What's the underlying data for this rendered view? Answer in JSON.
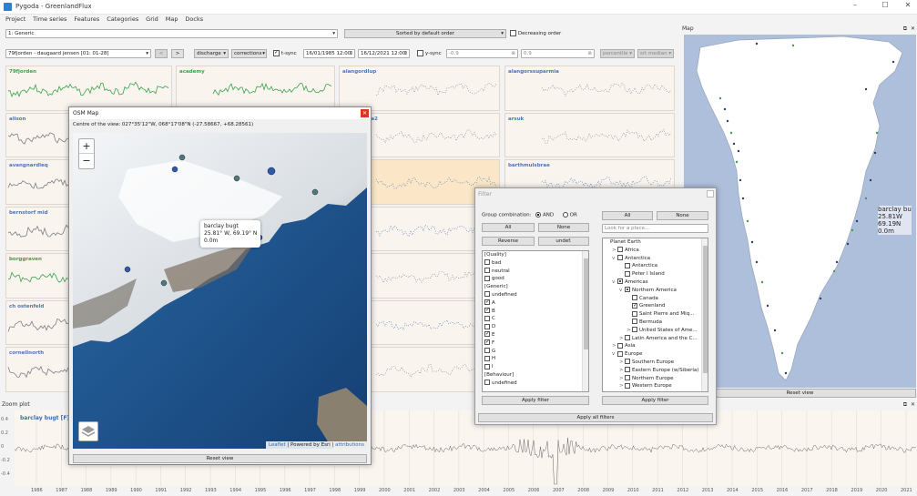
{
  "window": {
    "title": "Pygoda - GreenlandFlux",
    "minimize": "–",
    "maximize": "☐",
    "close": "✕"
  },
  "menu": [
    "Project",
    "Time series",
    "Features",
    "Categories",
    "Grid",
    "Map",
    "Docks"
  ],
  "toolbar1": {
    "group_select": "1: Generic",
    "sort_select": "Sorted by default order",
    "decreasing_label": "Decreasing order"
  },
  "toolbar2": {
    "station_select": "79fjorden - daugaard jensen [01: 01-28]",
    "prev": "<",
    "next": ">",
    "field_select": "discharge",
    "corrections_select": "corrections",
    "tsync_label": "t-sync",
    "date_from": "16/01/1985 12:00",
    "date_to": "16/12/2021 12:00",
    "ysync_label": "y-sync",
    "ymin": "-0.9",
    "ymax": "0.9",
    "percentile": "percentile",
    "sort_median": "srt median"
  },
  "panels": [
    "79fjorden",
    "academy",
    "alangordlup",
    "alangorssuparmia",
    "alison",
    "",
    "kangerdlua2",
    "arsuk",
    "avangnardleq",
    "",
    "…ugt [F]",
    "barthmulsbrae",
    "bernstorf mid",
    "",
    "…north2",
    "",
    "borggraven",
    "",
    "…ischer",
    "",
    "ch ostenfeld",
    "",
    "…V",
    "",
    "cornellnorth",
    "",
    "",
    ""
  ],
  "osm": {
    "title": "OSM Map",
    "centre": "Centre of the view: 027°35'12\"W, 068°17'08\"N (-27.58667, +68.28561)",
    "zoom_in": "+",
    "zoom_out": "−",
    "popup_name": "barclay bugt",
    "popup_coords": "25.81° W, 69.19° N",
    "popup_elev": "0.0m",
    "attribution_leaflet": "Leaflet",
    "attribution_esri": " | Powered by Esri | ",
    "attribution_link": "attributions",
    "reset": "Reset view",
    "layers_icon": "layers-icon"
  },
  "filter": {
    "title": "Filter",
    "group_combination": "Group combination:",
    "and_label": "AND",
    "or_label": "OR",
    "all": "All",
    "none": "None",
    "reverse": "Reverse",
    "undef": "undef.",
    "left_items": [
      {
        "label": "[Quality]",
        "cb": false,
        "show": false
      },
      {
        "label": "bad",
        "cb": true,
        "on": false
      },
      {
        "label": "neutral",
        "cb": true,
        "on": false
      },
      {
        "label": "good",
        "cb": true,
        "on": false
      },
      {
        "label": "[Generic]",
        "cb": false,
        "show": false
      },
      {
        "label": "undefined",
        "cb": true,
        "on": false
      },
      {
        "label": "A",
        "cb": true,
        "on": true
      },
      {
        "label": "B",
        "cb": true,
        "on": true
      },
      {
        "label": "C",
        "cb": true,
        "on": false
      },
      {
        "label": "D",
        "cb": true,
        "on": false
      },
      {
        "label": "E",
        "cb": true,
        "on": true
      },
      {
        "label": "F",
        "cb": true,
        "on": true
      },
      {
        "label": "G",
        "cb": true,
        "on": false
      },
      {
        "label": "H",
        "cb": true,
        "on": false
      },
      {
        "label": "I",
        "cb": true,
        "on": false
      },
      {
        "label": "[Behaviour]",
        "cb": false,
        "show": false
      },
      {
        "label": "undefined",
        "cb": true,
        "on": false
      }
    ],
    "right_all": "All",
    "right_none": "None",
    "place_placeholder": "Look for a place...",
    "tree": [
      {
        "label": "Planet Earth",
        "lvl": 0,
        "arrow": "",
        "cb": false
      },
      {
        "label": "Africa",
        "lvl": 1,
        "arrow": ">",
        "cb": true,
        "on": false
      },
      {
        "label": "Antarctica",
        "lvl": 1,
        "arrow": "v",
        "cb": true,
        "on": false
      },
      {
        "label": "Antarctica",
        "lvl": 2,
        "arrow": "",
        "cb": true,
        "on": false
      },
      {
        "label": "Peter I Island",
        "lvl": 2,
        "arrow": "",
        "cb": true,
        "on": false
      },
      {
        "label": "Americas",
        "lvl": 1,
        "arrow": "v",
        "cb": true,
        "on": "part"
      },
      {
        "label": "Northern America",
        "lvl": 2,
        "arrow": "v",
        "cb": true,
        "on": "part"
      },
      {
        "label": "Canada",
        "lvl": 3,
        "arrow": "",
        "cb": true,
        "on": false
      },
      {
        "label": "Greenland",
        "lvl": 3,
        "arrow": "",
        "cb": true,
        "on": true
      },
      {
        "label": "Saint Pierre and Miq...",
        "lvl": 3,
        "arrow": "",
        "cb": true,
        "on": false
      },
      {
        "label": "Bermuda",
        "lvl": 3,
        "arrow": "",
        "cb": true,
        "on": false
      },
      {
        "label": "United States of Ame...",
        "lvl": 3,
        "arrow": ">",
        "cb": true,
        "on": false
      },
      {
        "label": "Latin America and the C...",
        "lvl": 2,
        "arrow": ">",
        "cb": true,
        "on": false
      },
      {
        "label": "Asia",
        "lvl": 1,
        "arrow": ">",
        "cb": true,
        "on": false
      },
      {
        "label": "Europe",
        "lvl": 1,
        "arrow": "v",
        "cb": true,
        "on": false
      },
      {
        "label": "Southern Europe",
        "lvl": 2,
        "arrow": ">",
        "cb": true,
        "on": false
      },
      {
        "label": "Eastern Europe (w/Siberia)",
        "lvl": 2,
        "arrow": ">",
        "cb": true,
        "on": false
      },
      {
        "label": "Northern Europe",
        "lvl": 2,
        "arrow": ">",
        "cb": true,
        "on": false
      },
      {
        "label": "Western Europe",
        "lvl": 2,
        "arrow": ">",
        "cb": true,
        "on": false
      }
    ],
    "apply_left": "Apply filter",
    "apply_right": "Apply filter",
    "apply_all": "Apply all filters"
  },
  "map_dock": {
    "title": "Map",
    "label_name": "barclay bu",
    "label_lon": "25.81W",
    "label_lat": "69.19N",
    "label_elev": "0.0m",
    "reset": "Reset view",
    "float_icon": "float-icon",
    "close_icon": "close-icon"
  },
  "zoom": {
    "title": "Zoom plot",
    "series": "barclay bugt [F]",
    "yticks": [
      "0.4",
      "0.2",
      "0",
      "-0.2",
      "-0.4"
    ],
    "years": [
      "1986",
      "1987",
      "1988",
      "1989",
      "1990",
      "1991",
      "1992",
      "1993",
      "1994",
      "1995",
      "1996",
      "1997",
      "1998",
      "1999",
      "2000",
      "2001",
      "2002",
      "2003",
      "2004",
      "2005",
      "2006",
      "2007",
      "2008",
      "2009",
      "2010",
      "2011",
      "2012",
      "2013",
      "2014",
      "2015",
      "2016",
      "2017",
      "2018",
      "2019",
      "2020",
      "2021"
    ]
  },
  "colors": {
    "accent": "#4a76b4",
    "green": "#3aa149",
    "highlight": "#fbe7c8",
    "panel": "#faf4ef",
    "ocean": "#1d4f86",
    "rmap_bg": "#aebfdc"
  }
}
